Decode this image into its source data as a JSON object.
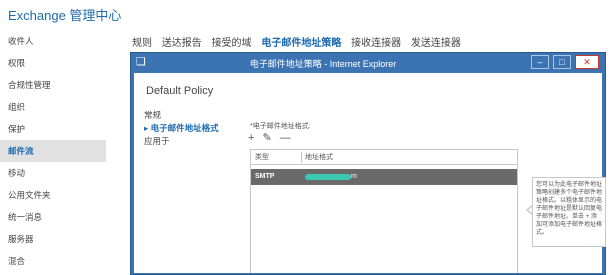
{
  "app": {
    "title": "Exchange 管理中心"
  },
  "sidebar": {
    "items": [
      {
        "label": "收件人"
      },
      {
        "label": "权限"
      },
      {
        "label": "合规性管理"
      },
      {
        "label": "组织"
      },
      {
        "label": "保护"
      },
      {
        "label": "邮件流",
        "active": true
      },
      {
        "label": "移动"
      },
      {
        "label": "公用文件夹"
      },
      {
        "label": "统一消息"
      },
      {
        "label": "服务器"
      },
      {
        "label": "混合"
      }
    ]
  },
  "topnav": {
    "tabs": [
      {
        "label": "规则"
      },
      {
        "label": "送达报告"
      },
      {
        "label": "接受的域"
      },
      {
        "label": "电子邮件地址策略",
        "active": true
      },
      {
        "label": "接收连接器"
      },
      {
        "label": "发送连接器"
      }
    ]
  },
  "dialog": {
    "window_title": "电子邮件地址策略 - Internet Explorer",
    "icon": "ie-page-icon",
    "policy_name": "Default Policy",
    "nav": [
      {
        "label": "常规"
      },
      {
        "label": "电子邮件地址格式",
        "active": true
      },
      {
        "label": "应用于"
      }
    ],
    "field_label": "*电子邮件地址格式:",
    "toolbar": {
      "add": "+",
      "edit": "✎",
      "remove": "—"
    },
    "grid": {
      "headers": [
        "类型",
        "地址格式"
      ],
      "rows": [
        {
          "type": "SMTP",
          "address_suffix": "m"
        }
      ]
    },
    "help_text": "您可以为此电子邮件地址策略创建多个电子邮件地址格式。以粗体显示的电子邮件地址是默认回复电子邮件地址。单击 + 添加可添加电子邮件地址格式。"
  },
  "colors": {
    "accent": "#1e6ab0",
    "ie_frame": "#3c74b3",
    "selected_row": "#6a6a6a",
    "redaction": "#3cc9b4"
  }
}
